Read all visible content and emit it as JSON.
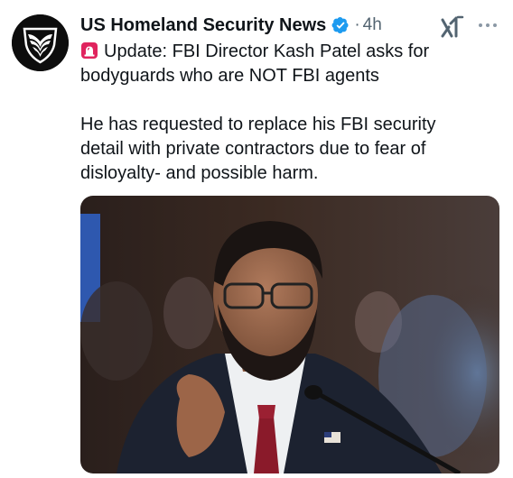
{
  "post": {
    "author": "US Homeland Security News",
    "separator": "·",
    "time": "4h",
    "headline": "Update: FBI Director Kash Patel asks for bodyguards who are NOT FBI agents",
    "body": "He has requested to replace his FBI security detail with private contractors due to fear of disloyalty- and possible harm."
  },
  "icons": {
    "verified": "verified-badge-icon",
    "siren": "police-light-emoji",
    "grok": "grok-icon",
    "more": "more-dots-icon",
    "avatar": "shield-eagle-logo"
  },
  "colors": {
    "verified": "#1d9bf0",
    "secondary_text": "#536471",
    "primary_text": "#0f1419"
  }
}
